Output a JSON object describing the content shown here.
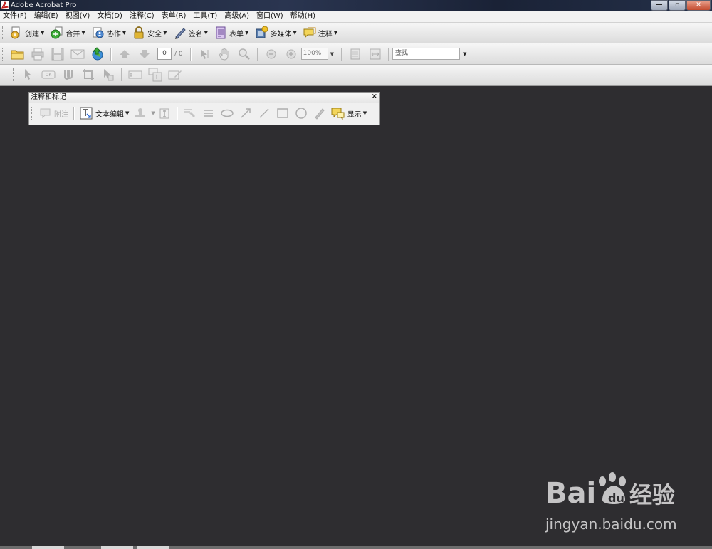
{
  "window": {
    "title": "Adobe Acrobat Pro",
    "minimize_label": "—",
    "maximize_label": "▫",
    "close_label": "✕"
  },
  "menu": {
    "items": [
      {
        "label": "文件(F)"
      },
      {
        "label": "编辑(E)"
      },
      {
        "label": "视图(V)"
      },
      {
        "label": "文档(D)"
      },
      {
        "label": "注释(C)"
      },
      {
        "label": "表单(R)"
      },
      {
        "label": "工具(T)"
      },
      {
        "label": "高级(A)"
      },
      {
        "label": "窗口(W)"
      },
      {
        "label": "帮助(H)"
      }
    ]
  },
  "toolbar1": {
    "create": "创建",
    "combine": "合并",
    "collaborate": "协作",
    "secure": "安全",
    "sign": "签名",
    "forms": "表单",
    "multimedia": "多媒体",
    "comment": "注释"
  },
  "toolbar2": {
    "page_number": "0",
    "page_total": "/ 0",
    "zoom": "100%",
    "search_placeholder": "查找"
  },
  "toolbar3": {
    "ok_label": "OK"
  },
  "panel": {
    "title": "注释和标记",
    "close": "×",
    "note": "附注",
    "text_edit": "文本编辑",
    "show": "显示"
  },
  "watermark": {
    "subtitle": "jingyan.baidu.com"
  },
  "colors": {
    "workspace": "#2e2d30",
    "chrome": "#f2f2f2",
    "titlebar": "#1b2334"
  }
}
